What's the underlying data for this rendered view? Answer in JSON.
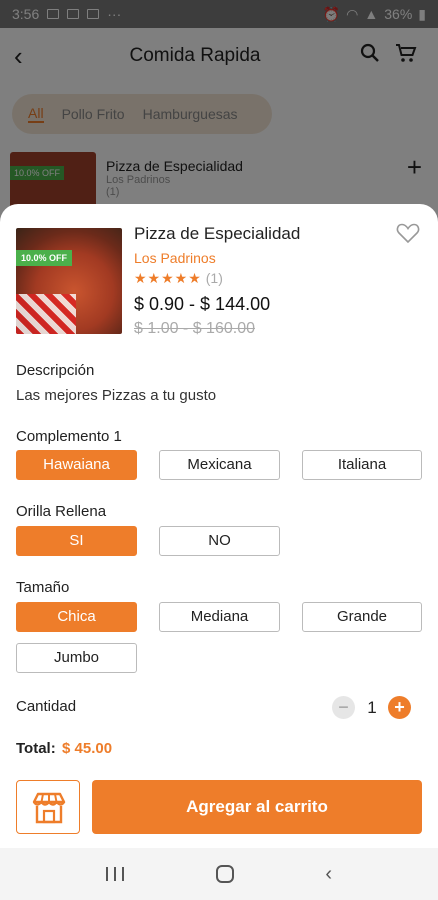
{
  "status_bar": {
    "time": "3:56",
    "dots": "···",
    "battery": "36%"
  },
  "header": {
    "title": "Comida Rapida"
  },
  "categories": {
    "items": [
      "All",
      "Pollo Frito",
      "Hamburguesas"
    ]
  },
  "list_item": {
    "name": "Pizza de Especialidad",
    "store": "Los Padrinos",
    "offer": "10.0% OFF",
    "rating_count": "(1)"
  },
  "product": {
    "offer": "10.0% OFF",
    "name": "Pizza de Especialidad",
    "store": "Los Padrinos",
    "stars": "★★★★★",
    "rating_count": "(1)",
    "price": "$ 0.90 - $ 144.00",
    "old_price": "$ 1.00 - $ 160.00"
  },
  "description": {
    "label": "Descripción",
    "text": "Las mejores Pizzas a tu gusto"
  },
  "options": [
    {
      "label": "Complemento 1",
      "choices": [
        "Hawaiana",
        "Mexicana",
        "Italiana"
      ],
      "selected": 0
    },
    {
      "label": "Orilla Rellena",
      "choices": [
        "SI",
        "NO"
      ],
      "selected": 0
    },
    {
      "label": "Tamaño",
      "choices": [
        "Chica",
        "Mediana",
        "Grande",
        "Jumbo"
      ],
      "selected": 0
    }
  ],
  "quantity": {
    "label": "Cantidad",
    "value": "1",
    "minus": "−",
    "plus": "+"
  },
  "total": {
    "label": "Total:",
    "value": "$ 45.00"
  },
  "actions": {
    "add_to_cart": "Agregar al carrito"
  },
  "colors": {
    "accent": "#ee7d2a",
    "offer_green": "#4bb04b"
  }
}
